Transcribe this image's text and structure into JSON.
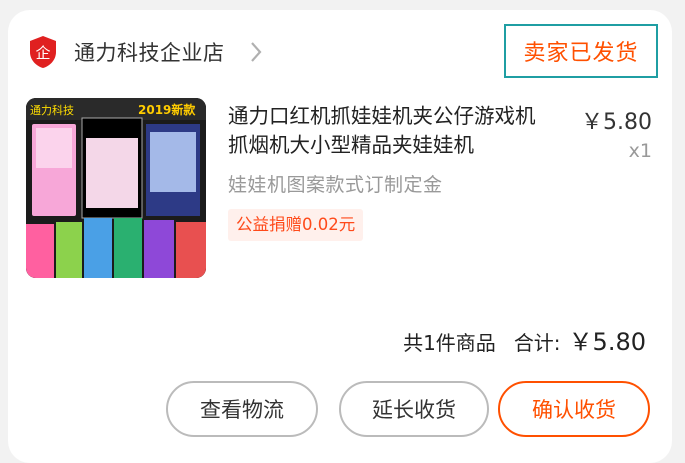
{
  "shop": {
    "name": "通力科技企业店",
    "icon": "shop-badge-icon",
    "icon_glyph": "企"
  },
  "order": {
    "status": "卖家已发货"
  },
  "product": {
    "title": "通力口红机抓娃娃机夹公仔游戏机抓烟机大小型精品夹娃娃机",
    "image_texts": {
      "brand": "通力科技",
      "badge": "2019新款"
    },
    "price": "￥5.80",
    "quantity": "x1",
    "spec": "娃娃机图案款式订制定金",
    "tag": "公益捐赠0.02元"
  },
  "summary": {
    "count_text": "共1件商品",
    "total_label": "合计:",
    "total_value": "￥5.80"
  },
  "actions": {
    "logistics": "查看物流",
    "extend": "延长收货",
    "confirm": "确认收货"
  },
  "colors": {
    "accent": "#ff5000",
    "status_border": "#1f9ea3",
    "shop_icon": "#e02020"
  }
}
